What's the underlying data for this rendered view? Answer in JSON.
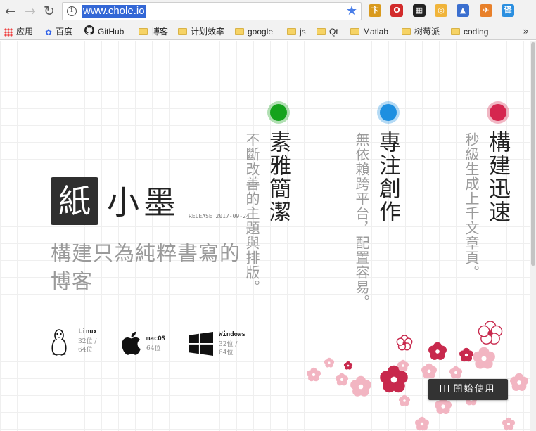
{
  "browser": {
    "back_icon": "back-arrow-icon",
    "forward_icon": "forward-arrow-icon",
    "reload_icon": "reload-icon",
    "url": "www.chole.io",
    "site_info_icon": "info-icon",
    "bookmark_star_icon": "star-icon",
    "extensions": [
      {
        "name": "ext-coin-icon",
        "glyph": "卞",
        "color": "#d99a1e"
      },
      {
        "name": "ext-opera-icon",
        "glyph": "O",
        "color": "#d22b2b"
      },
      {
        "name": "ext-qrcode-icon",
        "glyph": "▦",
        "color": "#222222"
      },
      {
        "name": "ext-circle-icon",
        "glyph": "◎",
        "color": "#f0b43a"
      },
      {
        "name": "ext-graduate-icon",
        "glyph": "▲",
        "color": "#3b6fcf"
      },
      {
        "name": "ext-fish-icon",
        "glyph": "✈",
        "color": "#e8802a"
      },
      {
        "name": "ext-translate-icon",
        "glyph": "译",
        "color": "#2b8fe0"
      }
    ]
  },
  "bookmarks": {
    "items": [
      {
        "label": "应用",
        "icon": "apps-icon"
      },
      {
        "label": "百度",
        "icon": "baidu-paw-icon"
      },
      {
        "label": "GitHub",
        "icon": "github-icon"
      },
      {
        "label": "博客",
        "icon": "folder-icon"
      },
      {
        "label": "计划效率",
        "icon": "folder-icon"
      },
      {
        "label": "google",
        "icon": "folder-icon"
      },
      {
        "label": "js",
        "icon": "folder-icon"
      },
      {
        "label": "Qt",
        "icon": "folder-icon"
      },
      {
        "label": "Matlab",
        "icon": "folder-icon"
      },
      {
        "label": "树莓派",
        "icon": "folder-icon"
      },
      {
        "label": "coding",
        "icon": "folder-icon"
      }
    ],
    "more": "»"
  },
  "hero": {
    "logo_char": "紙",
    "name": "小墨",
    "release": "RELEASE 2017-09-24",
    "tagline": "構建只為純粹書寫的博客"
  },
  "features": [
    {
      "title": "素雅簡潔",
      "desc": "不斷改善的主題與排版。",
      "dot_color": "#14a31c"
    },
    {
      "title": "專注創作",
      "desc": "無依賴跨平台，配置容易。",
      "dot_color": "#1e8fe0"
    },
    {
      "title": "構建迅速",
      "desc": "秒級生成上千文章頁。",
      "dot_color": "#d5264f"
    }
  ],
  "platforms": [
    {
      "name": "Linux",
      "bits": "32位 / 64位",
      "icon": "linux-tux-icon"
    },
    {
      "name": "macOS",
      "bits": "64位",
      "icon": "apple-icon"
    },
    {
      "name": "Windows",
      "bits": "32位 / 64位",
      "icon": "windows-icon"
    }
  ],
  "start_button": {
    "label": "開始使用",
    "icon": "book-icon"
  },
  "colors": {
    "blossom_red": "#c8294d",
    "blossom_pink": "#f2b5c2",
    "dark": "#333333"
  }
}
